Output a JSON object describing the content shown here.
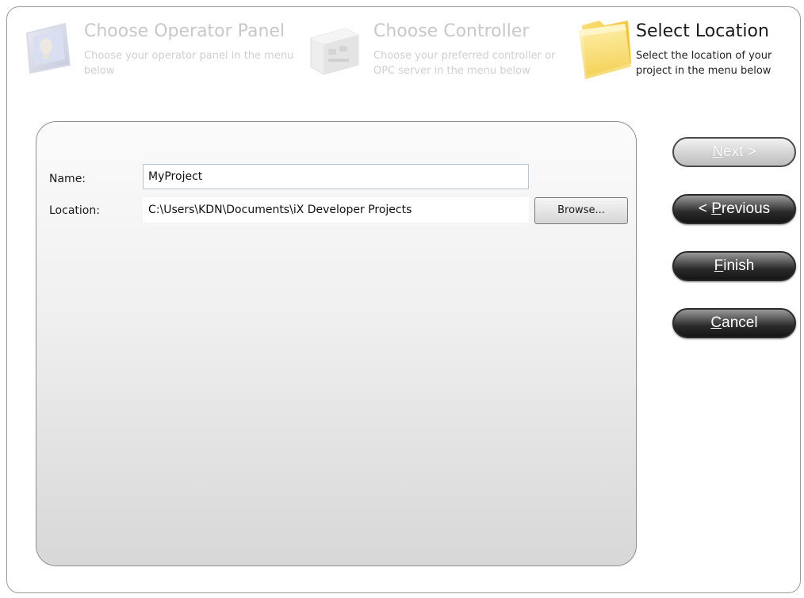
{
  "steps": [
    {
      "title": "Choose Operator Panel",
      "description": "Choose your operator panel in the menu below",
      "icon": "operator-panel-icon",
      "state": "inactive"
    },
    {
      "title": "Choose Controller",
      "description": "Choose your preferred controller or OPC server in the menu below",
      "icon": "controller-icon",
      "state": "inactive"
    },
    {
      "title": "Select Location",
      "description": "Select the location of your project in the menu below",
      "icon": "folder-icon",
      "state": "active"
    }
  ],
  "form": {
    "name_label": "Name:",
    "name_value": "MyProject",
    "location_label": "Location:",
    "location_value": "C:\\Users\\KDN\\Documents\\iX Developer Projects",
    "browse_label": "Browse..."
  },
  "nav": {
    "next": {
      "mnemonic": "N",
      "rest": "ext >",
      "enabled": false
    },
    "previous": {
      "prefix": "< ",
      "mnemonic": "P",
      "rest": "revious",
      "enabled": true
    },
    "finish": {
      "mnemonic": "F",
      "rest": "inish",
      "enabled": true
    },
    "cancel": {
      "mnemonic": "C",
      "rest": "ancel",
      "enabled": true
    }
  },
  "colors": {
    "active_text": "#1a1a1a",
    "inactive_text": "#c8c8c8",
    "input_border": "#b5c6d8",
    "button_dark": "#141414"
  }
}
